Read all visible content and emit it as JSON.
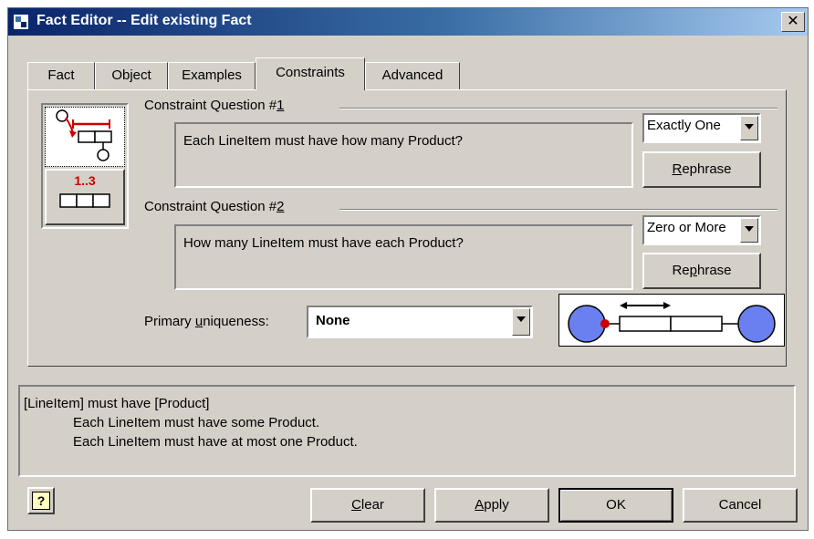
{
  "window": {
    "title": "Fact Editor -- Edit existing Fact",
    "close_glyph": "✕"
  },
  "tabs": [
    {
      "label": "Fact"
    },
    {
      "label": "Object"
    },
    {
      "label": "Examples"
    },
    {
      "label": "Constraints",
      "active": true
    },
    {
      "label": "Advanced"
    }
  ],
  "view_selector": {
    "range_label": "1..3",
    "selected": "diagram-view"
  },
  "constraint1": {
    "group_label": "Constraint Question #1",
    "group_label_main": "Constraint Question #",
    "group_label_mnemonic": "1",
    "question": "Each LineItem must have how many Product?",
    "select_value": "Exactly One",
    "rephrase_prefix": "",
    "rephrase_mnemonic": "R",
    "rephrase_rest": "ephrase"
  },
  "constraint2": {
    "group_label": "Constraint Question #2",
    "group_label_main": "Constraint Question #",
    "group_label_mnemonic": "2",
    "question": "How many LineItem must have each Product?",
    "select_value": "Zero or More",
    "rephrase_prefix": "Re",
    "rephrase_mnemonic": "p",
    "rephrase_rest": "hrase"
  },
  "primary_uniqueness": {
    "label": "Primary uniqueness:",
    "label_pre": "Primary ",
    "label_mnemonic": "u",
    "label_post": "niqueness:",
    "value": "None"
  },
  "verbalization": {
    "lines": [
      "[LineItem] must have [Product]",
      "Each LineItem must have some Product.",
      "Each LineItem must have at most one Product."
    ]
  },
  "buttons": {
    "help_glyph": "?",
    "clear_mnemonic": "C",
    "clear_rest": "lear",
    "apply_mnemonic": "A",
    "apply_rest": "pply",
    "ok": "OK",
    "cancel": "Cancel"
  },
  "colors": {
    "accent_red": "#cc0000",
    "role_fill": "#6b80f0",
    "title_start": "#0a246a",
    "title_end": "#a6caf0"
  }
}
